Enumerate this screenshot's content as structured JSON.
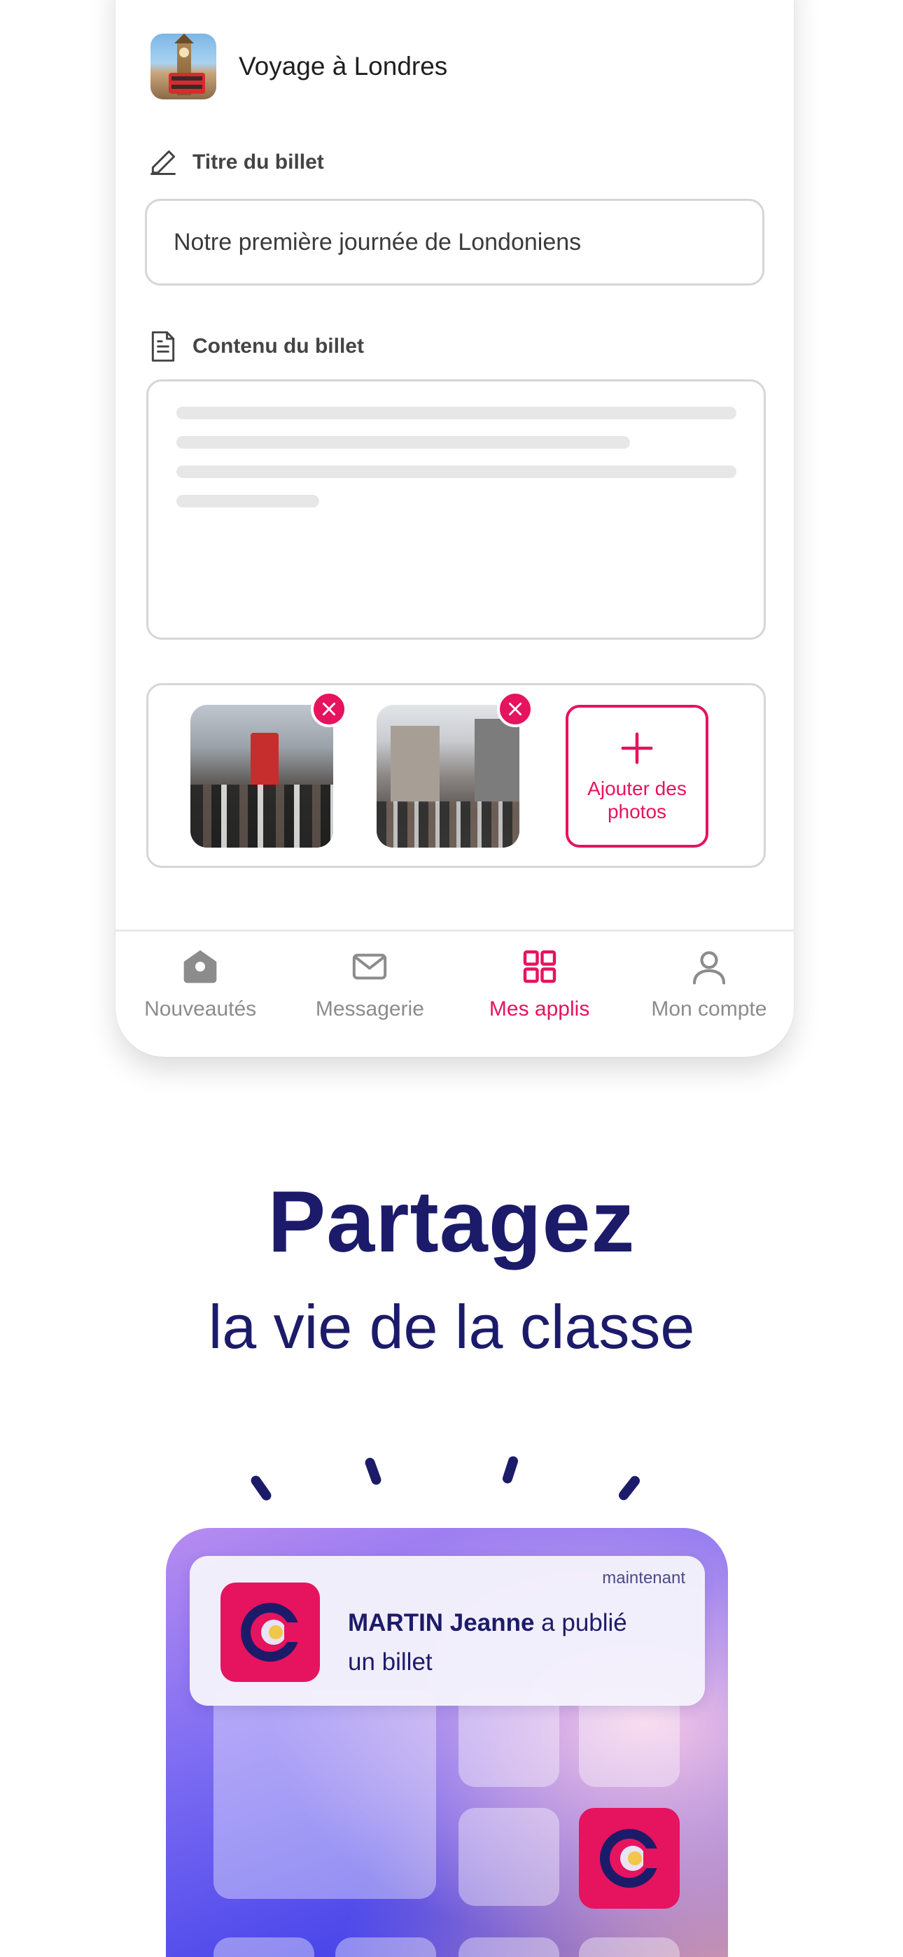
{
  "app": {
    "name": "Voyage à Londres"
  },
  "form": {
    "title_label": "Titre du billet",
    "title_value": "Notre première journée de Londoniens",
    "content_label": "Contenu du billet",
    "add_photos_label": "Ajouter des photos"
  },
  "nav": {
    "items": [
      {
        "label": "Nouveautés",
        "icon": "home-icon",
        "active": false
      },
      {
        "label": "Messagerie",
        "icon": "mail-icon",
        "active": false
      },
      {
        "label": "Mes applis",
        "icon": "apps-grid-icon",
        "active": true
      },
      {
        "label": "Mon compte",
        "icon": "user-icon",
        "active": false
      }
    ]
  },
  "marketing": {
    "headline": "Partagez",
    "subline": "la vie de la classe"
  },
  "notification": {
    "time": "maintenant",
    "author": "MARTIN Jeanne",
    "action": "a publié",
    "object": "un billet"
  },
  "colors": {
    "accent": "#e6135e",
    "navy": "#1c1b6a",
    "inactive": "#8c8c8c"
  }
}
